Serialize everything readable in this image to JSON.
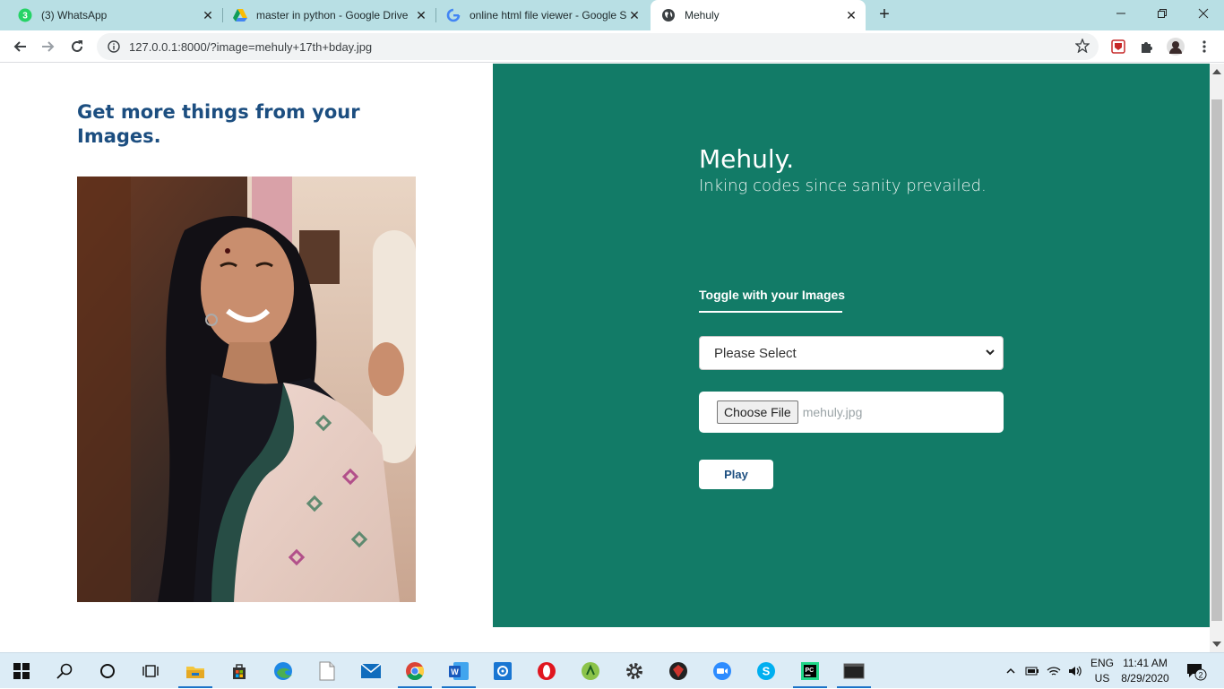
{
  "browser": {
    "tabs": [
      {
        "title": "(3) WhatsApp",
        "icon": "whatsapp-icon",
        "badge": "3"
      },
      {
        "title": "master in python - Google Drive",
        "icon": "google-drive-icon"
      },
      {
        "title": "online html file viewer - Google S",
        "icon": "google-icon"
      },
      {
        "title": "Mehuly",
        "icon": "globe-icon",
        "active": true
      }
    ],
    "new_tab_symbol": "+",
    "url": "127.0.0.1:8000/?image=mehuly+17th+bday.jpg"
  },
  "page": {
    "heading": "Get more things from your Images.",
    "photo_icon": "portrait-photo",
    "brand": "Mehuly.",
    "tagline": "Inking codes since sanity prevailed.",
    "toggle_label": "Toggle with your Images",
    "select": {
      "value": "Please Select"
    },
    "file_input": {
      "button_label": "Choose File",
      "file_name": "mehuly.jpg"
    },
    "play_label": "Play",
    "accent_color": "#127b67",
    "heading_color": "#1c4e80"
  },
  "taskbar": {
    "apps": [
      "windows-start-icon",
      "search-icon",
      "cortana-icon",
      "task-view-icon",
      "file-explorer-icon",
      "store-icon",
      "edge-icon",
      "notepad-icon",
      "mail-icon",
      "chrome-icon",
      "word-icon",
      "settings-app-icon",
      "opera-icon",
      "android-studio-icon",
      "gear-icon",
      "ruby-icon",
      "zoom-icon",
      "skype-icon",
      "pycharm-icon",
      "terminal-icon"
    ],
    "lang_line1": "ENG",
    "lang_line2": "US",
    "time": "11:41 AM",
    "date": "8/29/2020",
    "notification_count": "2"
  }
}
